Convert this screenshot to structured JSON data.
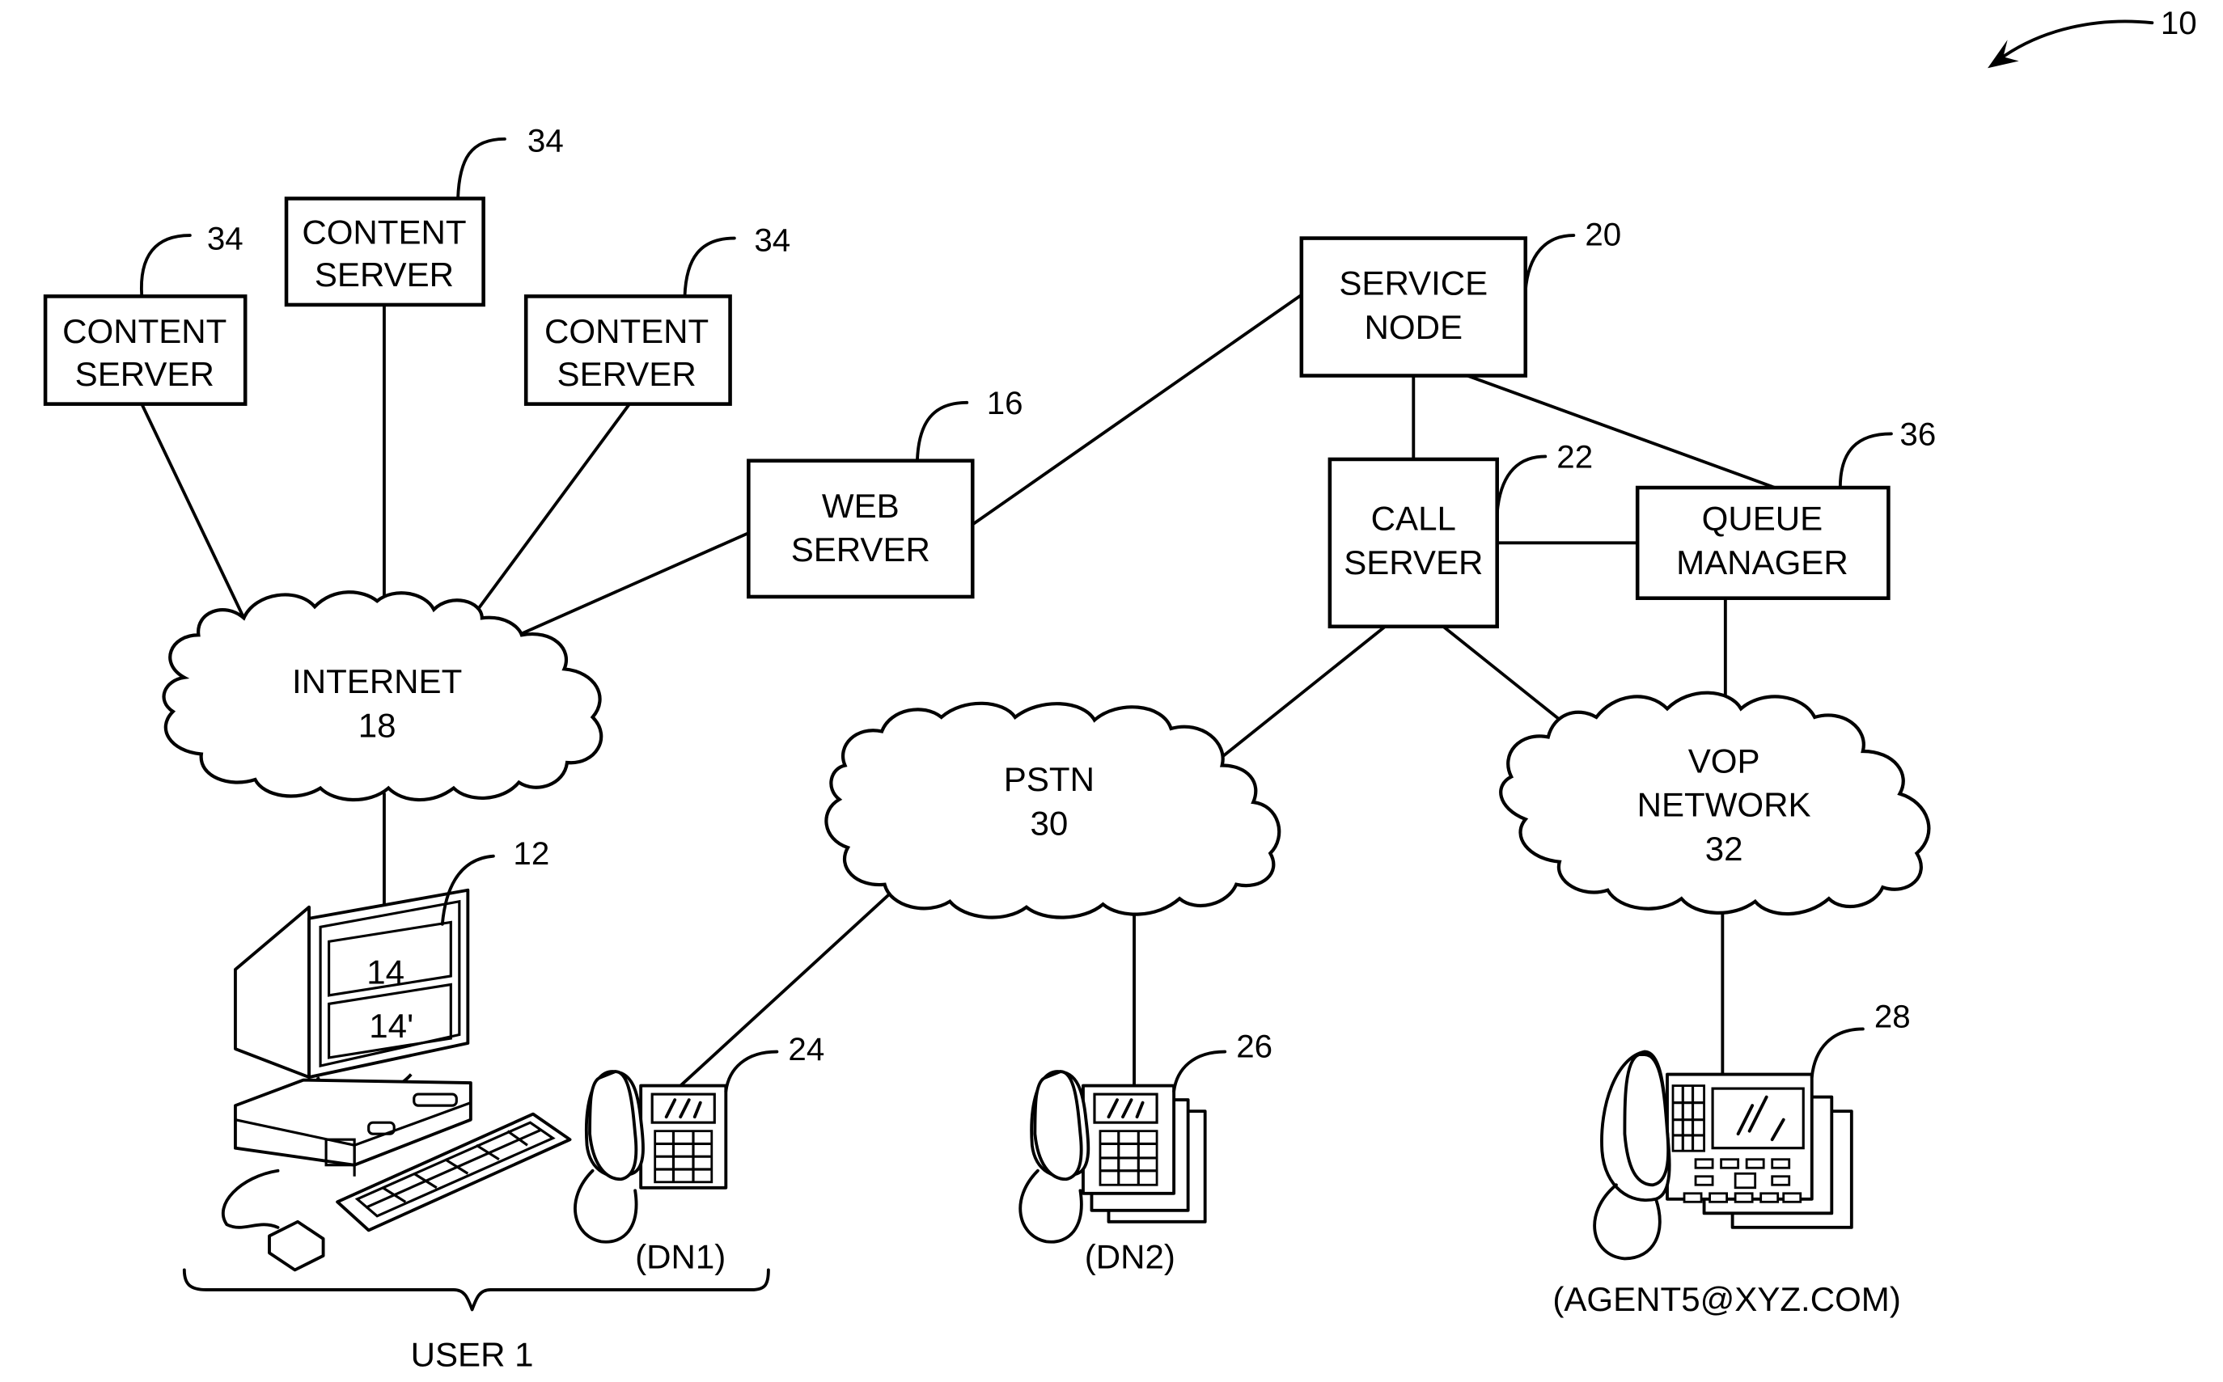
{
  "figure": {
    "ref": "10",
    "nodes": {
      "content_server_a": {
        "lines": [
          "CONTENT",
          "SERVER"
        ],
        "ref": "34"
      },
      "content_server_b": {
        "lines": [
          "CONTENT",
          "SERVER"
        ],
        "ref": "34"
      },
      "content_server_c": {
        "lines": [
          "CONTENT",
          "SERVER"
        ],
        "ref": "34"
      },
      "web_server": {
        "lines": [
          "WEB",
          "SERVER"
        ],
        "ref": "16"
      },
      "service_node": {
        "lines": [
          "SERVICE",
          "NODE"
        ],
        "ref": "20"
      },
      "call_server": {
        "lines": [
          "CALL",
          "SERVER"
        ],
        "ref": "22"
      },
      "queue_manager": {
        "lines": [
          "QUEUE",
          "MANAGER"
        ],
        "ref": "36"
      },
      "internet": {
        "lines": [
          "INTERNET",
          "18"
        ]
      },
      "pstn": {
        "lines": [
          "PSTN",
          "30"
        ]
      },
      "vop_network": {
        "lines": [
          "VOP",
          "NETWORK",
          "32"
        ]
      },
      "computer": {
        "ref": "12",
        "windows": [
          "14",
          "14'"
        ]
      },
      "phone_dn1": {
        "ref": "24",
        "label": "(DN1)"
      },
      "phone_dn2": {
        "ref": "26",
        "label": "(DN2)"
      },
      "phone_agent": {
        "ref": "28",
        "label": "(AGENT5@XYZ.COM)"
      },
      "user_group": {
        "label": "USER 1"
      }
    }
  }
}
